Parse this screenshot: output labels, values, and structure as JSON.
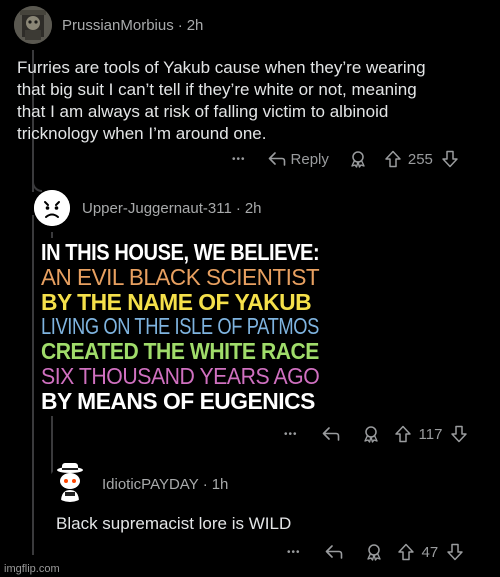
{
  "comments": [
    {
      "username": "PrussianMorbius",
      "time": "2h",
      "text_lines": [
        "Furries are tools of Yakub cause when they’re wearing",
        "that big suit I can’t tell if they’re white or not, meaning",
        "that I am always at risk of falling victim to albinoid",
        "tricknology when I’m around one."
      ],
      "actions": {
        "more": "•••",
        "reply": "Reply",
        "votes": "255"
      }
    },
    {
      "username": "Upper-Juggernaut-311",
      "time": "2h",
      "meme_lines": [
        {
          "text": "IN THIS HOUSE, WE BELIEVE:",
          "color": "#ffffff",
          "weight": "bold"
        },
        {
          "text": "AN EVIL BLACK SCIENTIST",
          "color": "#e8a060",
          "weight": "normal"
        },
        {
          "text": "BY THE NAME OF YAKUB",
          "color": "#f5e04a",
          "weight": "bold"
        },
        {
          "text": "LIVING ON THE ISLE OF PATMOS",
          "color": "#7fb4e0",
          "weight": "normal"
        },
        {
          "text": "CREATED THE WHITE RACE",
          "color": "#a0dc6a",
          "weight": "bold"
        },
        {
          "text": "SIX THOUSAND YEARS AGO",
          "color": "#d070c0",
          "weight": "normal"
        },
        {
          "text": "BY MEANS OF EUGENICS",
          "color": "#ffffff",
          "weight": "bold"
        }
      ],
      "actions": {
        "more": "•••",
        "votes": "117"
      }
    },
    {
      "username": "IdioticPAYDAY",
      "time": "1h",
      "text": "Black supremacist lore is WILD",
      "actions": {
        "more": "•••",
        "votes": "47"
      }
    }
  ],
  "watermark": "imgflip.com",
  "colors": {
    "background": "#000000",
    "text": "#e3e5e6",
    "muted": "#9a9c9e",
    "thread": "#3a3a3c"
  }
}
